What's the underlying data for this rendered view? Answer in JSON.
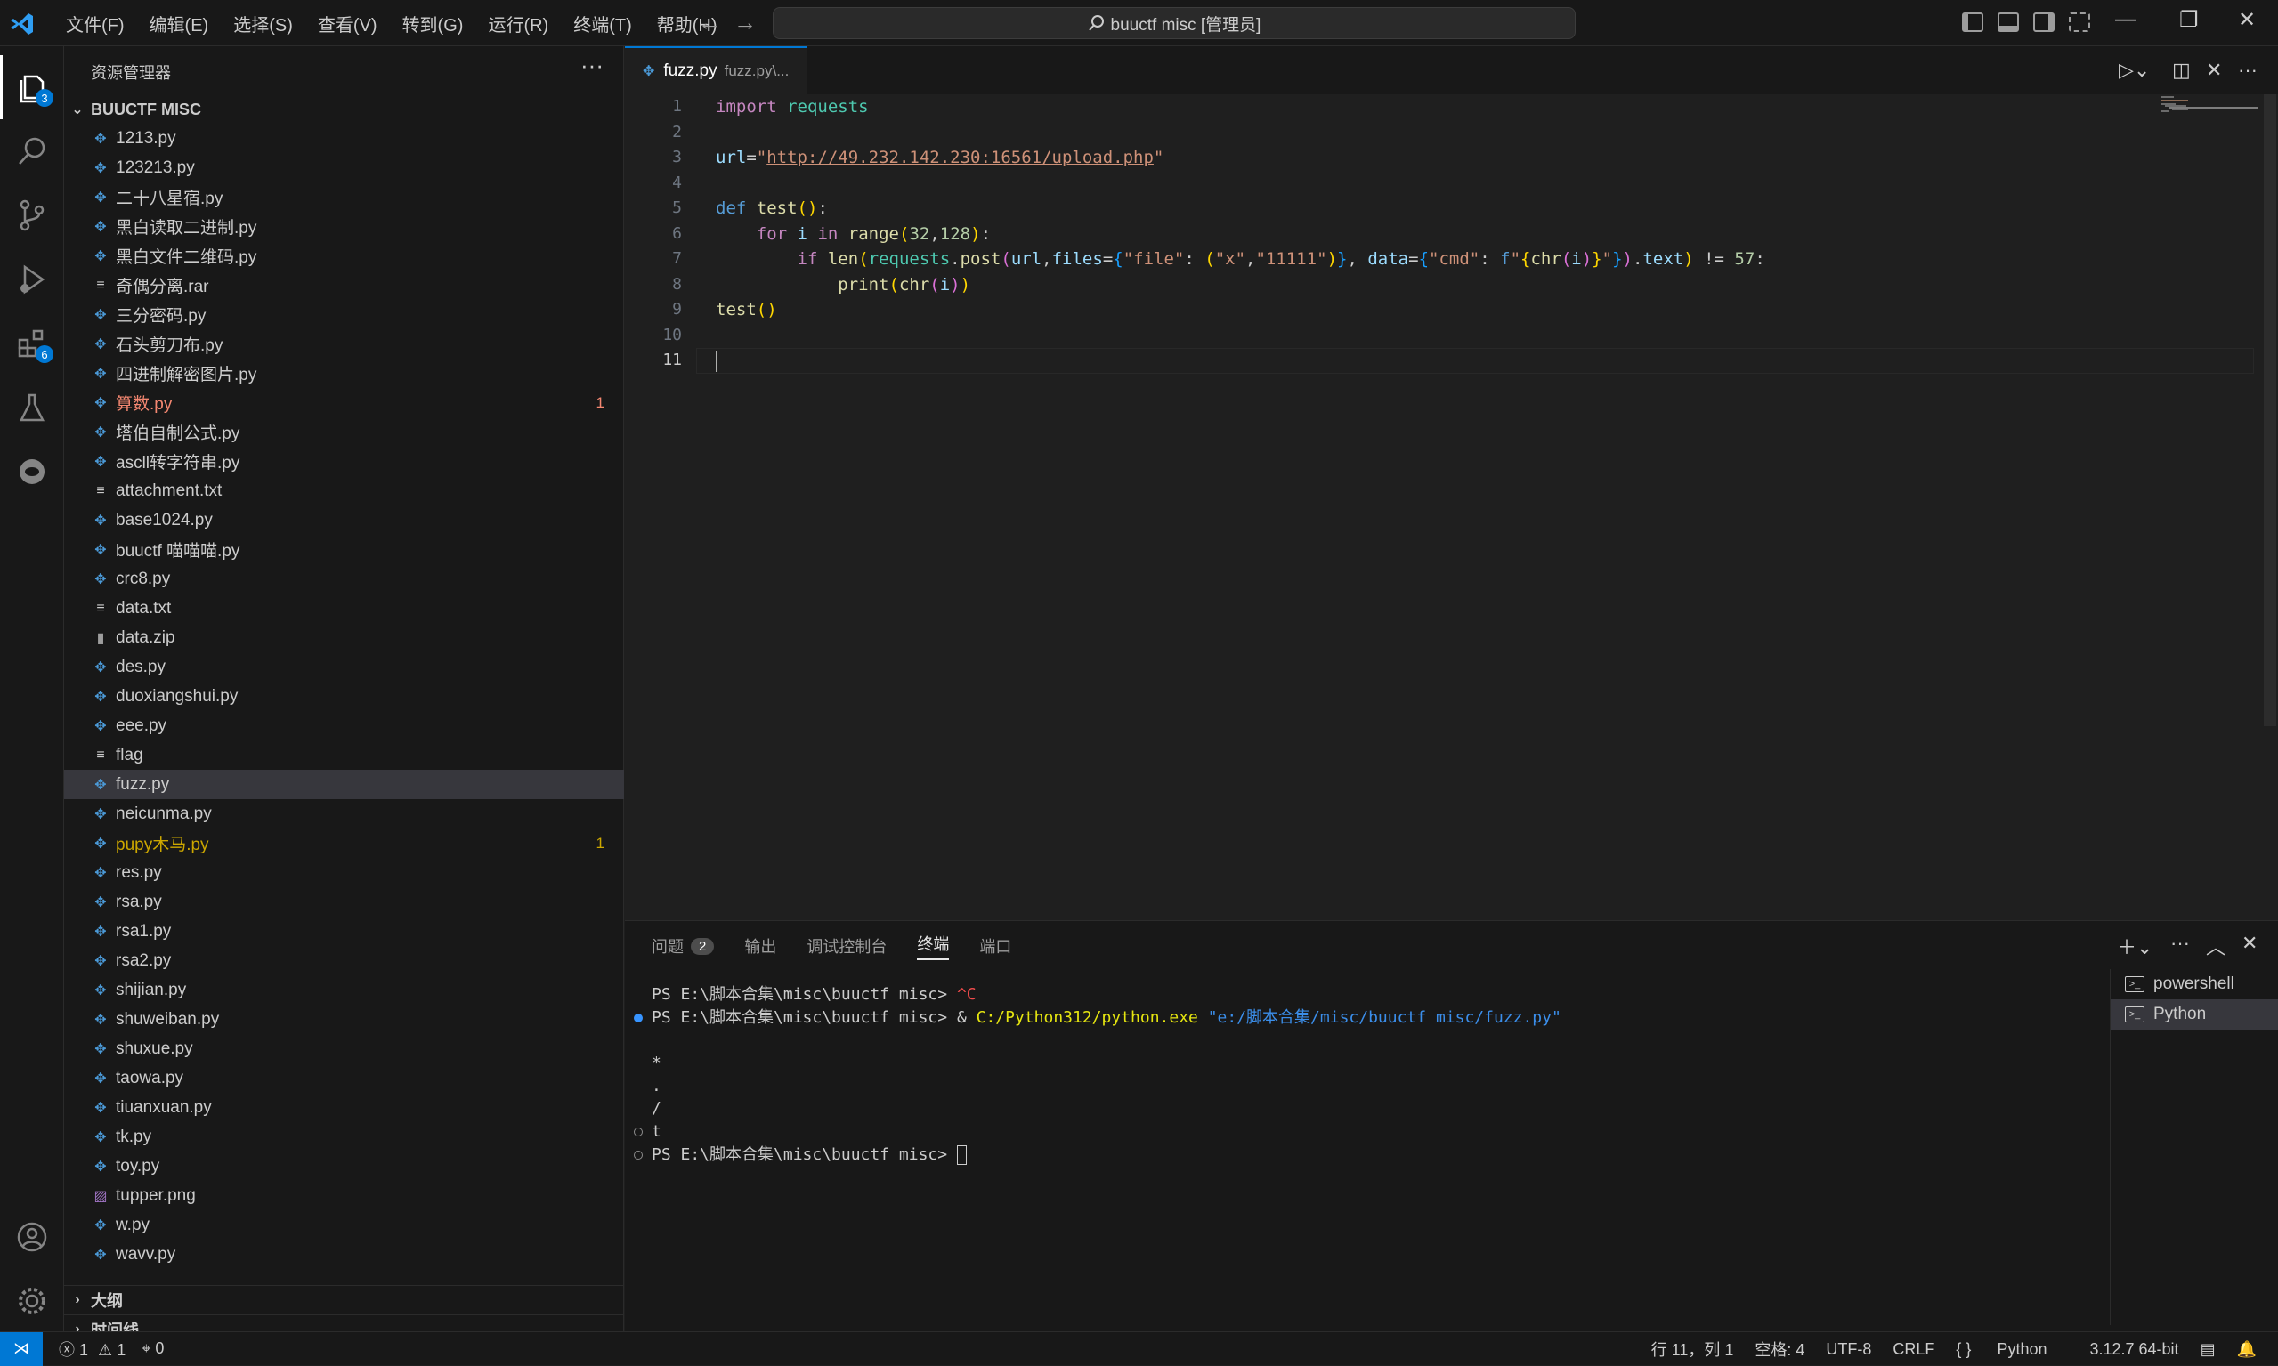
{
  "titlebar": {
    "menu": [
      "文件(F)",
      "编辑(E)",
      "选择(S)",
      "查看(V)",
      "转到(G)",
      "运行(R)",
      "终端(T)",
      "帮助(H)"
    ],
    "search_text": "buuctf misc [管理员]"
  },
  "activity": {
    "explorer_badge": "3",
    "extensions_badge": "6"
  },
  "sidebar": {
    "title": "资源管理器",
    "folder": "BUUCTF MISC",
    "files": [
      {
        "name": "1213.py",
        "icon": "python"
      },
      {
        "name": "123213.py",
        "icon": "python"
      },
      {
        "name": "二十八星宿.py",
        "icon": "python"
      },
      {
        "name": "黑白读取二进制.py",
        "icon": "python"
      },
      {
        "name": "黑白文件二维码.py",
        "icon": "python"
      },
      {
        "name": "奇偶分离.rar",
        "icon": "text"
      },
      {
        "name": "三分密码.py",
        "icon": "python"
      },
      {
        "name": "石头剪刀布.py",
        "icon": "python"
      },
      {
        "name": "四进制解密图片.py",
        "icon": "python"
      },
      {
        "name": "算数.py",
        "icon": "python",
        "status": "error",
        "count": "1"
      },
      {
        "name": "塔伯自制公式.py",
        "icon": "python"
      },
      {
        "name": "ascll转字符串.py",
        "icon": "python"
      },
      {
        "name": "attachment.txt",
        "icon": "text"
      },
      {
        "name": "base1024.py",
        "icon": "python"
      },
      {
        "name": "buuctf 喵喵喵.py",
        "icon": "python"
      },
      {
        "name": "crc8.py",
        "icon": "python"
      },
      {
        "name": "data.txt",
        "icon": "text"
      },
      {
        "name": "data.zip",
        "icon": "zip"
      },
      {
        "name": "des.py",
        "icon": "python"
      },
      {
        "name": "duoxiangshui.py",
        "icon": "python"
      },
      {
        "name": "eee.py",
        "icon": "python"
      },
      {
        "name": "flag",
        "icon": "text"
      },
      {
        "name": "fuzz.py",
        "icon": "python",
        "selected": true
      },
      {
        "name": "neicunma.py",
        "icon": "python"
      },
      {
        "name": "pupy木马.py",
        "icon": "python",
        "status": "warning",
        "count": "1"
      },
      {
        "name": "res.py",
        "icon": "python"
      },
      {
        "name": "rsa.py",
        "icon": "python"
      },
      {
        "name": "rsa1.py",
        "icon": "python"
      },
      {
        "name": "rsa2.py",
        "icon": "python"
      },
      {
        "name": "shijian.py",
        "icon": "python"
      },
      {
        "name": "shuweiban.py",
        "icon": "python"
      },
      {
        "name": "shuxue.py",
        "icon": "python"
      },
      {
        "name": "taowa.py",
        "icon": "python"
      },
      {
        "name": "tiuanxuan.py",
        "icon": "python"
      },
      {
        "name": "tk.py",
        "icon": "python"
      },
      {
        "name": "toy.py",
        "icon": "python"
      },
      {
        "name": "tupper.png",
        "icon": "image"
      },
      {
        "name": "w.py",
        "icon": "python"
      },
      {
        "name": "wavv.py",
        "icon": "python"
      }
    ],
    "outline": "大纲",
    "timeline": "时间线"
  },
  "editor": {
    "tab_name": "fuzz.py",
    "tab_desc": "fuzz.py\\...",
    "line_numbers": [
      "1",
      "2",
      "3",
      "4",
      "5",
      "6",
      "7",
      "8",
      "9",
      "10",
      "11"
    ]
  },
  "panel": {
    "tabs": [
      "问题",
      "输出",
      "调试控制台",
      "终端",
      "端口"
    ],
    "problems_count": "2",
    "terminal_lines": {
      "l1_prompt": "PS E:\\脚本合集\\misc\\buuctf misc> ",
      "l1_cmd": "^C",
      "l2_prompt": "PS E:\\脚本合集\\misc\\buuctf misc> ",
      "l2_amp": "& ",
      "l2_exe": "C:/Python312/python.exe",
      "l2_arg": " \"e:/脚本合集/misc/buuctf misc/fuzz.py\"",
      "out1": "*",
      "out2": ".",
      "out3": "/",
      "out4": "t",
      "l_final": "PS E:\\脚本合集\\misc\\buuctf misc> "
    },
    "terminals": [
      "powershell",
      "Python"
    ]
  },
  "statusbar": {
    "errors": "1",
    "warnings": "1",
    "ports": "0",
    "position": "行 11，列 1",
    "spaces": "空格: 4",
    "encoding": "UTF-8",
    "eol": "CRLF",
    "language": "Python",
    "interpreter": "3.12.7 64-bit"
  }
}
